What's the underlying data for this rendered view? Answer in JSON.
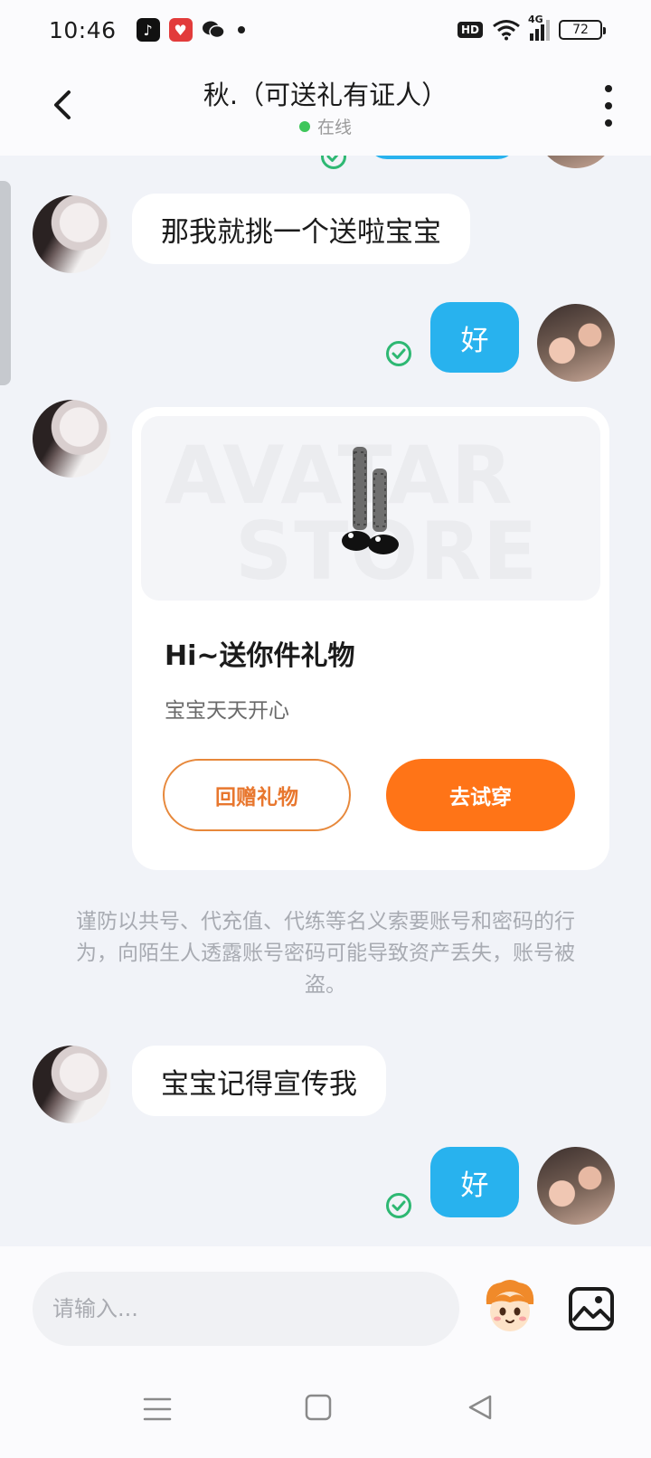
{
  "status_bar": {
    "time": "10:46",
    "hd": "HD",
    "network": "4G",
    "battery": "72"
  },
  "header": {
    "title": "秋.（可送礼有证人）",
    "status": "在线",
    "status_color": "#3ec65a"
  },
  "messages": {
    "m1": "那我就挑一个送啦宝宝",
    "m2": "好",
    "m3": "宝宝记得宣传我",
    "m4": "好"
  },
  "gift_card": {
    "watermark_line1": "AVATAR",
    "watermark_line2": "STORE",
    "title": "Hi~送你件礼物",
    "subtitle": "宝宝天天开心",
    "return_gift_label": "回赠礼物",
    "try_on_label": "去试穿",
    "accent_color": "#ff7417"
  },
  "notice": "谨防以共号、代充值、代练等名义索要账号和密码的行为，向陌生人透露账号密码可能导致资产丢失，账号被盗。",
  "input": {
    "placeholder": "请输入..."
  },
  "colors": {
    "outgoing_bubble": "#28b2ee",
    "read_check": "#2eb873"
  },
  "icons": [
    "back-arrow-icon",
    "more-vertical-icon",
    "check-circle-icon",
    "emoji-mascot-icon",
    "image-icon",
    "nav-menu-icon",
    "nav-home-icon",
    "nav-back-icon"
  ]
}
